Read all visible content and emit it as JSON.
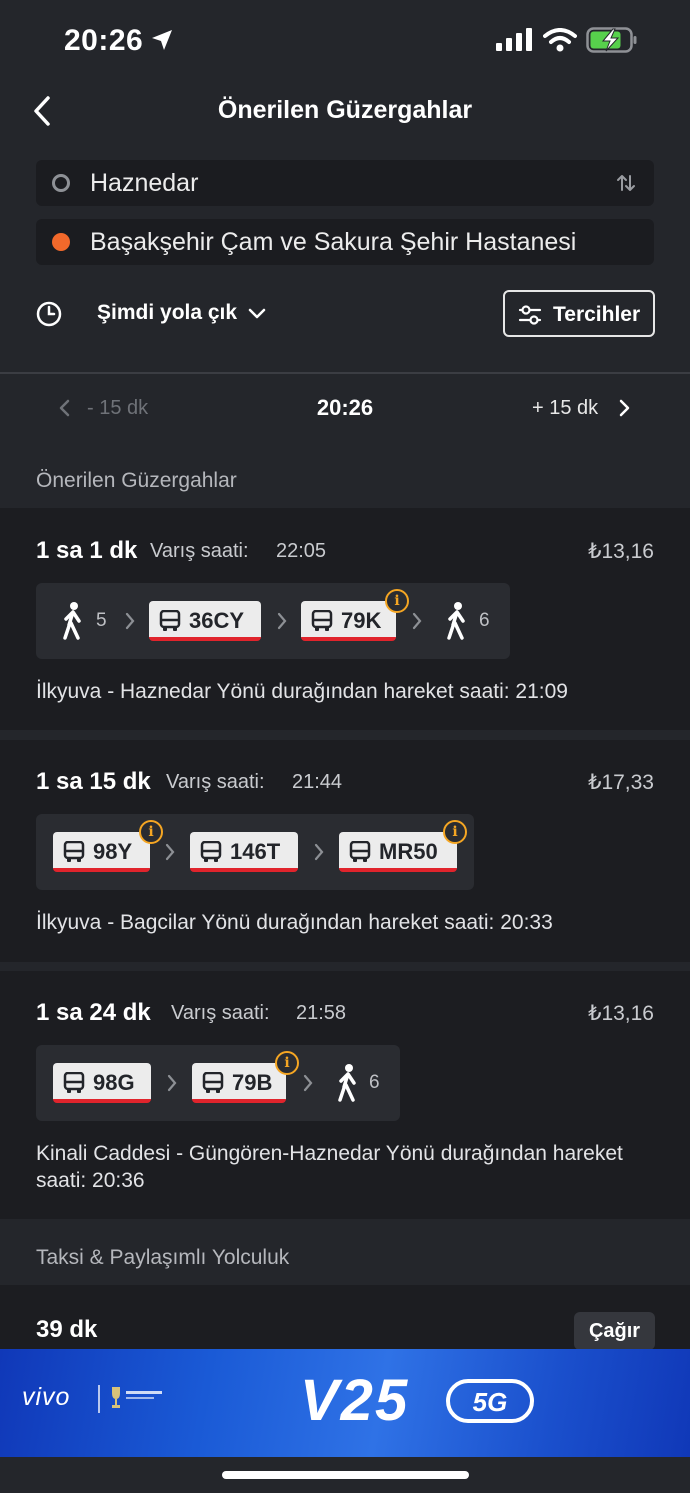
{
  "status": {
    "time": "20:26"
  },
  "header": {
    "title": "Önerilen Güzergahlar"
  },
  "route": {
    "origin": "Haznedar",
    "destination": "Başakşehir Çam ve Sakura Şehir Hastanesi",
    "origin_dot_color": "#8e9196",
    "destination_dot_color": "#f2692b"
  },
  "depart": {
    "label": "Şimdi yola çık"
  },
  "preferences": {
    "label": "Tercihler"
  },
  "time_nav": {
    "prev": "- 15 dk",
    "current": "20:26",
    "next": "+ 15 dk"
  },
  "section_routes": "Önerilen Güzergahlar",
  "arrival_label": "Varış saati:",
  "routes": [
    {
      "duration": "1 sa 1 dk",
      "arrival": "22:05",
      "price": "₺13,16",
      "walk_start": "5",
      "bus1": "36CY",
      "bus2": "79K",
      "walk_end": "6",
      "description": "İlkyuva - Haznedar Yönü durağından hareket saati: 21:09"
    },
    {
      "duration": "1 sa 15 dk",
      "arrival": "21:44",
      "price": "₺17,33",
      "bus1": "98Y",
      "bus2": "146T",
      "bus3": "MR50",
      "description": "İlkyuva - Bagcilar Yönü durağından hareket saati: 20:33"
    },
    {
      "duration": "1 sa 24 dk",
      "arrival": "21:58",
      "price": "₺13,16",
      "bus1": "98G",
      "bus2": "79B",
      "walk_end": "6",
      "description": "Kinali Caddesi - Güngören-Haznedar Yönü durağından hareket saati: 20:36"
    }
  ],
  "section_taxi": "Taksi & Paylaşımlı Yolculuk",
  "taxi": {
    "duration": "39 dk",
    "call": "Çağır"
  },
  "ad": {
    "brand": "vivo",
    "model": "V25",
    "badge": "5G"
  },
  "colors": {
    "accent_red": "#e0242c",
    "info_orange": "#f5a623"
  }
}
